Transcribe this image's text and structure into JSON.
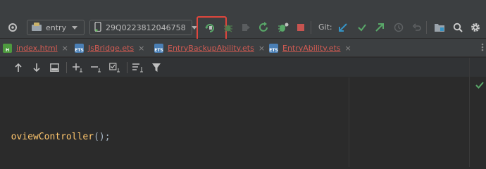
{
  "toolbar": {
    "module_selector": {
      "value": "entry",
      "icon": "module-icon"
    },
    "device_selector": {
      "value": "29Q0223812046758",
      "icon": "phone-icon"
    },
    "git_label": "Git:",
    "accent_highlight": "#e0463d"
  },
  "tabs": [
    {
      "label": "index.html",
      "icon": "html-file-icon",
      "icon_color": "#4e9a3f"
    },
    {
      "label": "JsBridge.ets",
      "icon": "ets-file-icon",
      "icon_color": "#4a7fb5"
    },
    {
      "label": "EntryBackupAbility.ets",
      "icon": "ets-file-icon",
      "icon_color": "#4a7fb5"
    },
    {
      "label": "EntryAbility.ets",
      "icon": "ets-file-icon",
      "icon_color": "#4a7fb5"
    }
  ],
  "tab_close_glyph": "×",
  "editor": {
    "code_fragment_fn": "oviewController",
    "code_fragment_tail": "();"
  },
  "file_tag": {
    "html": "H",
    "ets": "ETS"
  }
}
